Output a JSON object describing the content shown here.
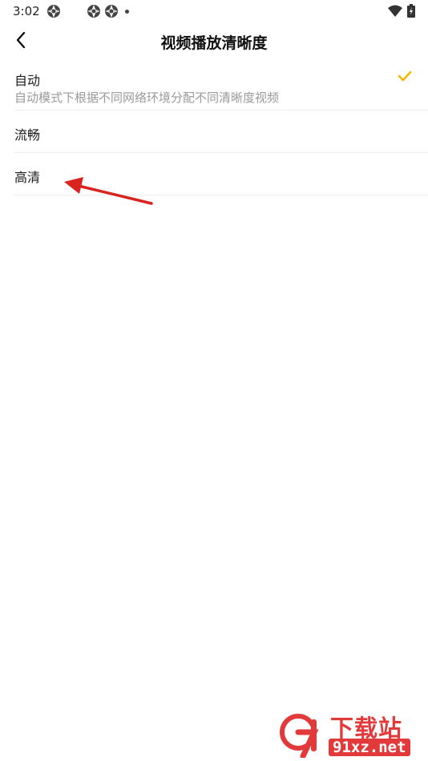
{
  "status_bar": {
    "time": "3:02",
    "left_icons": [
      "aperture-icon",
      "aperture-icon",
      "aperture-icon",
      "dot-icon"
    ],
    "right_icons": [
      "wifi-icon",
      "battery-charging-icon"
    ]
  },
  "header": {
    "back_icon": "chevron-left-icon",
    "title": "视频播放清晰度"
  },
  "options": [
    {
      "label": "自动",
      "description": "自动模式下根据不同网络环境分配不同清晰度视频",
      "selected": true
    },
    {
      "label": "流畅",
      "selected": false
    },
    {
      "label": "高清",
      "selected": false
    }
  ],
  "annotation": {
    "type": "arrow",
    "color": "#d9231f",
    "points_to": "高清"
  },
  "watermark": {
    "title": "下载站",
    "domain": "91xz.net"
  },
  "colors": {
    "accent_check": "#f5b800",
    "divider": "#ececec",
    "secondary_text": "#9a9a9a",
    "watermark_red": "#e23a3a"
  }
}
